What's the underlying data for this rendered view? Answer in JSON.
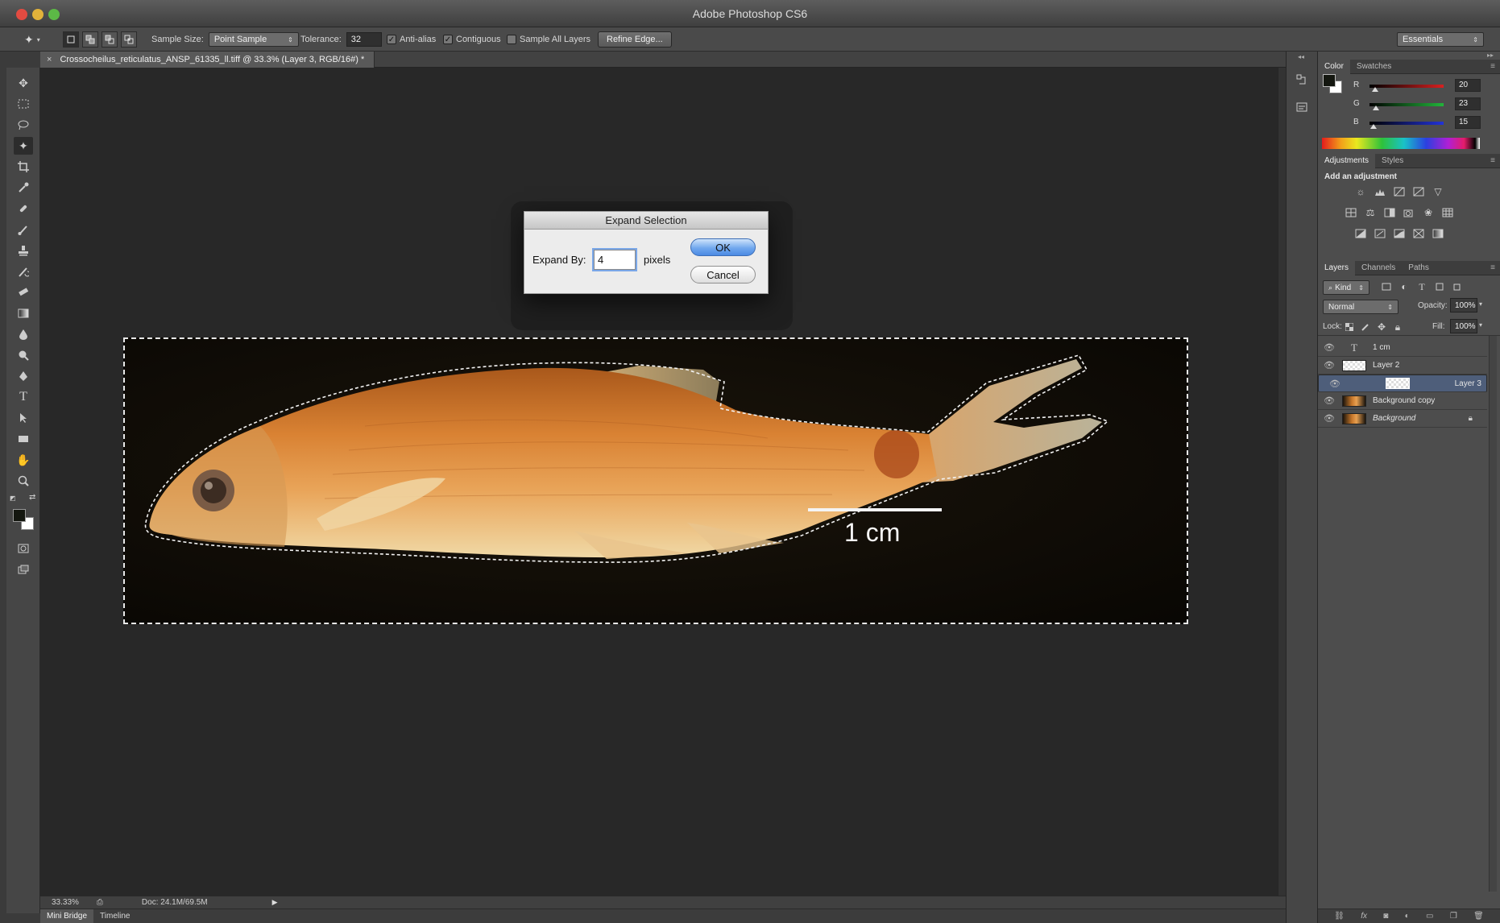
{
  "window": {
    "title": "Adobe Photoshop CS6"
  },
  "options_bar": {
    "sample_size_label": "Sample Size:",
    "sample_size_value": "Point Sample",
    "tolerance_label": "Tolerance:",
    "tolerance_value": "32",
    "anti_alias_label": "Anti-alias",
    "anti_alias_checked": true,
    "contiguous_label": "Contiguous",
    "contiguous_checked": true,
    "sample_all_layers_label": "Sample All Layers",
    "sample_all_layers_checked": false,
    "refine_edge_label": "Refine Edge...",
    "workspace_value": "Essentials"
  },
  "document": {
    "tab_title": "Crossocheilus_reticulatus_ANSP_61335_ll.tiff @ 33.3% (Layer 3, RGB/16#) *",
    "scale_bar_text": "1 cm"
  },
  "status_bar": {
    "zoom": "33.33%",
    "doc_info": "Doc: 24.1M/69.5M"
  },
  "bottom_tabs": [
    {
      "label": "Mini Bridge",
      "active": true
    },
    {
      "label": "Timeline",
      "active": false
    }
  ],
  "dialog": {
    "title": "Expand Selection",
    "expand_label": "Expand By:",
    "expand_value": "4",
    "units": "pixels",
    "ok_label": "OK",
    "cancel_label": "Cancel"
  },
  "color_panel": {
    "tabs": [
      "Color",
      "Swatches"
    ],
    "channels": [
      {
        "label": "R",
        "value": "20",
        "fraction": 0.078,
        "color": "#d72020"
      },
      {
        "label": "G",
        "value": "23",
        "fraction": 0.09,
        "color": "#22b43a"
      },
      {
        "label": "B",
        "value": "15",
        "fraction": 0.059,
        "color": "#2233d8"
      }
    ],
    "foreground": "#141710",
    "background": "#ffffff"
  },
  "adjustments_panel": {
    "tabs": [
      "Adjustments",
      "Styles"
    ],
    "heading": "Add an adjustment"
  },
  "layers_panel": {
    "tabs": [
      "Layers",
      "Channels",
      "Paths"
    ],
    "filter_kind": "Kind",
    "blend_mode": "Normal",
    "opacity_label": "Opacity:",
    "opacity_value": "100%",
    "lock_label": "Lock:",
    "fill_label": "Fill:",
    "fill_value": "100%",
    "layers": [
      {
        "name": "1 cm",
        "type": "text",
        "selected": false,
        "locked": false
      },
      {
        "name": "Layer 2",
        "type": "transparent",
        "selected": false,
        "locked": false
      },
      {
        "name": "Layer 3",
        "type": "transparent",
        "selected": true,
        "locked": false
      },
      {
        "name": "Background copy",
        "type": "image",
        "selected": false,
        "locked": false
      },
      {
        "name": "Background",
        "type": "image",
        "selected": false,
        "locked": true
      }
    ]
  }
}
